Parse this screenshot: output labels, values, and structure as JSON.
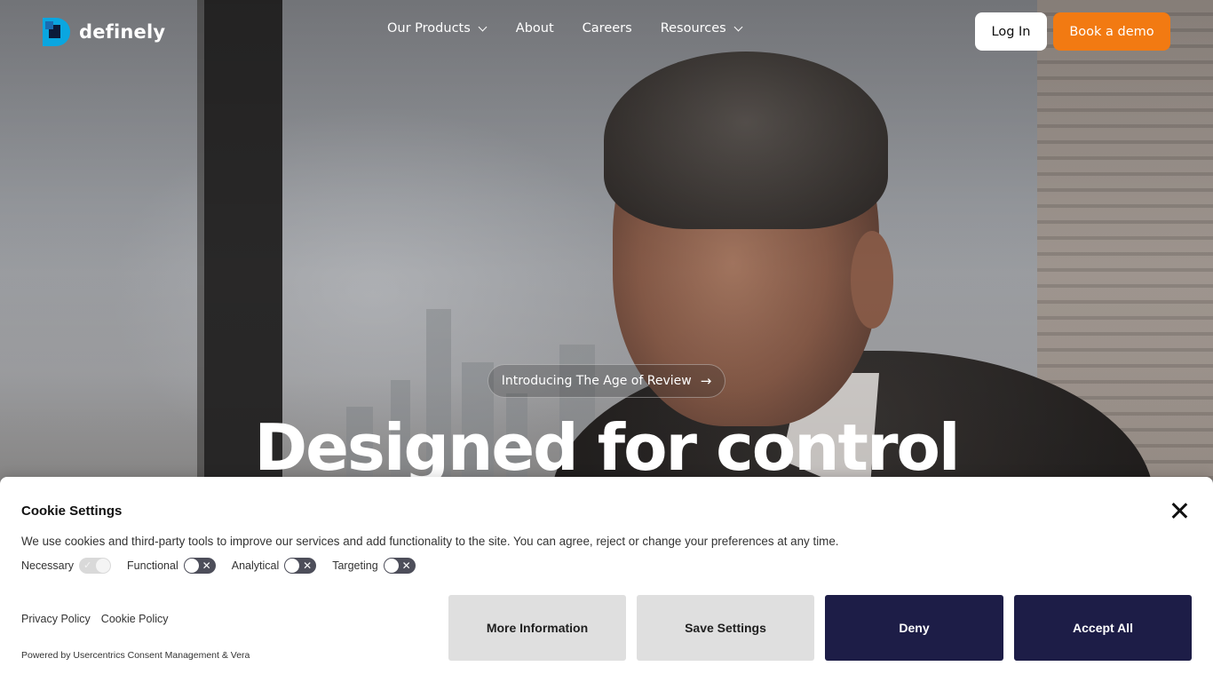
{
  "nav": {
    "logo_text": "definely",
    "menu": [
      {
        "label": "Our Products",
        "has_dropdown": true
      },
      {
        "label": "About",
        "has_dropdown": false
      },
      {
        "label": "Careers",
        "has_dropdown": false
      },
      {
        "label": "Resources",
        "has_dropdown": true
      }
    ],
    "login_label": "Log In",
    "demo_label": "Book a demo"
  },
  "hero": {
    "pill_text": "Introducing The Age of Review",
    "pill_arrow": "→",
    "headline": "Designed for control"
  },
  "cookie": {
    "title": "Cookie Settings",
    "description": "We use cookies and third-party tools to improve our services and add functionality to the site. You can agree, reject or change your preferences at any time.",
    "toggles": [
      {
        "label": "Necessary",
        "state": "on-disabled"
      },
      {
        "label": "Functional",
        "state": "off"
      },
      {
        "label": "Analytical",
        "state": "off"
      },
      {
        "label": "Targeting",
        "state": "off"
      }
    ],
    "links": [
      "Privacy Policy",
      "Cookie Policy"
    ],
    "powered_by": "Powered by Usercentrics Consent Management & Vera",
    "buttons": {
      "more_info": "More Information",
      "save": "Save Settings",
      "deny": "Deny",
      "accept": "Accept All"
    }
  },
  "colors": {
    "brand_orange": "#f27a12",
    "logo_blue": "#0aa6e0",
    "cookie_dark_button": "#1d1d47",
    "cookie_grey_button": "#dfdfdf"
  }
}
